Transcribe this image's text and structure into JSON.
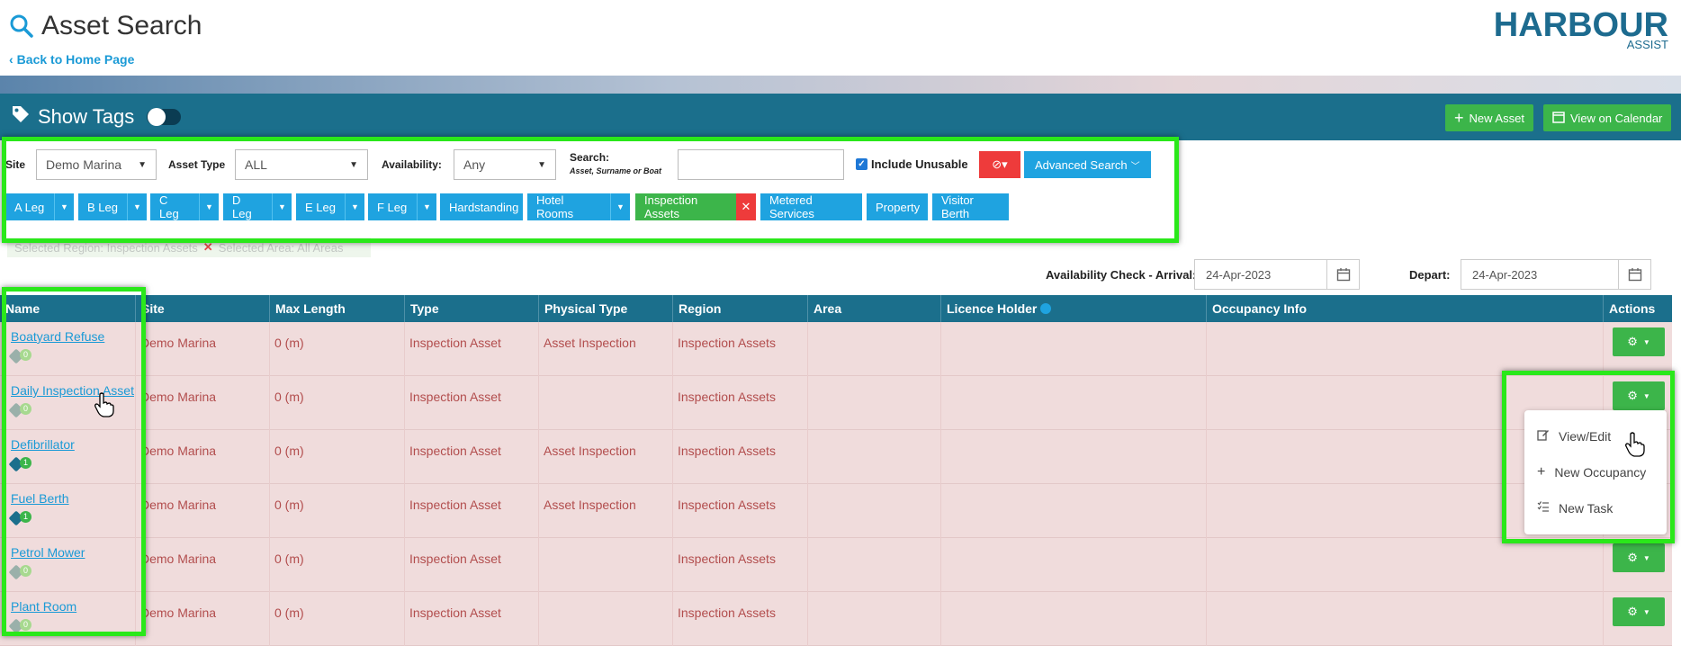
{
  "header": {
    "title": "Asset Search",
    "back_link": "Back to Home Page",
    "logo_main": "HARBOUR",
    "logo_sub": "ASSIST"
  },
  "toolbar": {
    "show_tags_label": "Show Tags",
    "new_asset_label": "New Asset",
    "view_calendar_label": "View on Calendar"
  },
  "filters": {
    "site_label": "Site",
    "site_value": "Demo Marina",
    "asset_type_label": "Asset Type",
    "asset_type_value": "ALL",
    "availability_label": "Availability:",
    "availability_value": "Any",
    "search_label": "Search:",
    "search_hint": "Asset, Surname or Boat",
    "search_value": "",
    "include_unusable_label": "Include Unusable",
    "include_unusable_checked": true,
    "advanced_search_label": "Advanced Search"
  },
  "regions": [
    {
      "label": "A Leg",
      "dropdown": true,
      "active": false
    },
    {
      "label": "B Leg",
      "dropdown": true,
      "active": false
    },
    {
      "label": "C Leg",
      "dropdown": true,
      "active": false
    },
    {
      "label": "D Leg",
      "dropdown": true,
      "active": false
    },
    {
      "label": "E Leg",
      "dropdown": true,
      "active": false
    },
    {
      "label": "F Leg",
      "dropdown": true,
      "active": false
    },
    {
      "label": "Hardstanding",
      "dropdown": false,
      "active": false
    },
    {
      "label": "Hotel Rooms",
      "dropdown": true,
      "active": false
    },
    {
      "label": "Inspection Assets",
      "dropdown": false,
      "active": true
    },
    {
      "label": "Metered Services",
      "dropdown": false,
      "active": false
    },
    {
      "label": "Property",
      "dropdown": false,
      "active": false
    },
    {
      "label": "Visitor Berth",
      "dropdown": false,
      "active": false
    }
  ],
  "selection": {
    "region_text": "Selected Region: Inspection Assets",
    "area_text": "Selected Area: All Areas"
  },
  "availability_check": {
    "arrival_label": "Availability Check - Arrival:",
    "arrival_value": "24-Apr-2023",
    "depart_label": "Depart:",
    "depart_value": "24-Apr-2023"
  },
  "table": {
    "columns": [
      "Name",
      "Site",
      "Max Length",
      "Type",
      "Physical Type",
      "Region",
      "Area",
      "Licence Holder",
      "Occupancy Info",
      "Actions"
    ],
    "rows": [
      {
        "name": "Boatyard Refuse",
        "tag_count": "0",
        "site": "Demo Marina",
        "max_length": "0 (m)",
        "type": "Inspection Asset",
        "physical_type": "Asset Inspection",
        "region": "Inspection Assets"
      },
      {
        "name": "Daily Inspection Asset",
        "tag_count": "0",
        "site": "Demo Marina",
        "max_length": "0 (m)",
        "type": "Inspection Asset",
        "physical_type": "",
        "region": "Inspection Assets"
      },
      {
        "name": "Defibrillator",
        "tag_count": "1",
        "site": "Demo Marina",
        "max_length": "0 (m)",
        "type": "Inspection Asset",
        "physical_type": "Asset Inspection",
        "region": "Inspection Assets"
      },
      {
        "name": "Fuel Berth",
        "tag_count": "1",
        "site": "Demo Marina",
        "max_length": "0 (m)",
        "type": "Inspection Asset",
        "physical_type": "Asset Inspection",
        "region": "Inspection Assets"
      },
      {
        "name": "Petrol Mower",
        "tag_count": "0",
        "site": "Demo Marina",
        "max_length": "0 (m)",
        "type": "Inspection Asset",
        "physical_type": "",
        "region": "Inspection Assets"
      },
      {
        "name": "Plant Room",
        "tag_count": "0",
        "site": "Demo Marina",
        "max_length": "0 (m)",
        "type": "Inspection Asset",
        "physical_type": "",
        "region": "Inspection Assets"
      }
    ]
  },
  "action_menu": {
    "items": [
      "View/Edit",
      "New Occupancy",
      "New Task"
    ]
  },
  "colors": {
    "teal": "#1b6f8c",
    "blue": "#1fa3e0",
    "green": "#3cb54a",
    "red": "#ee3b3b",
    "highlight": "#2ae81a",
    "row_bg": "#f0dcdc"
  }
}
